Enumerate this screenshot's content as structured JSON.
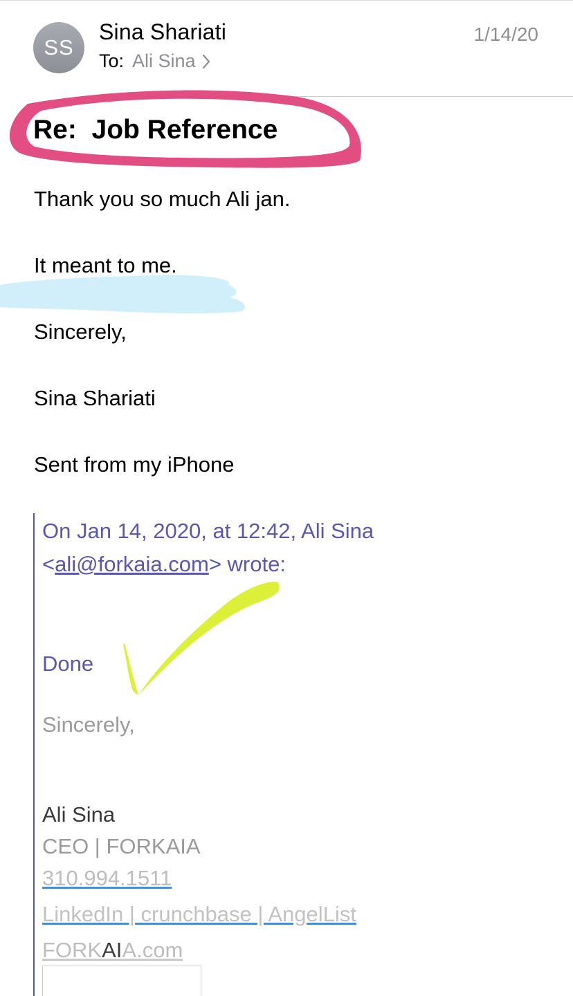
{
  "header": {
    "avatar_initials": "SS",
    "sender_name": "Sina Shariati",
    "to_label": "To:",
    "to_name": "Ali Sina",
    "date": "1/14/20"
  },
  "subject": "Re:  Job Reference",
  "body": {
    "line1": "Thank you so much Ali jan.",
    "line2": "It meant to me.",
    "line3": "Sincerely,",
    "line4": "Sina Shariati",
    "line5": "Sent from my iPhone"
  },
  "quote": {
    "attribution_line1": "On Jan 14, 2020, at 12:42, Ali Sina",
    "attribution_lt": "<",
    "attribution_email": "ali@forkaia.com",
    "attribution_tail": "> wrote:",
    "reply": "Done",
    "closing": "Sincerely,"
  },
  "signature": {
    "name": "Ali Sina",
    "title": "CEO | FORKAIA",
    "phone": "310.994.1511",
    "linkedin": "LinkedIn",
    "sep1": " | ",
    "crunchbase": "crunchbase",
    "sep2": " | ",
    "angellist": "AngelList",
    "site_a": "FORK",
    "site_b": "AI",
    "site_c": "A.com"
  },
  "colors": {
    "quote_text": "#5b57b0",
    "quote_bar": "#5a55a8",
    "subject_circle": "#e0457a",
    "highlight_blue": "#cdeefb",
    "checkmark": "#dcf03a"
  }
}
